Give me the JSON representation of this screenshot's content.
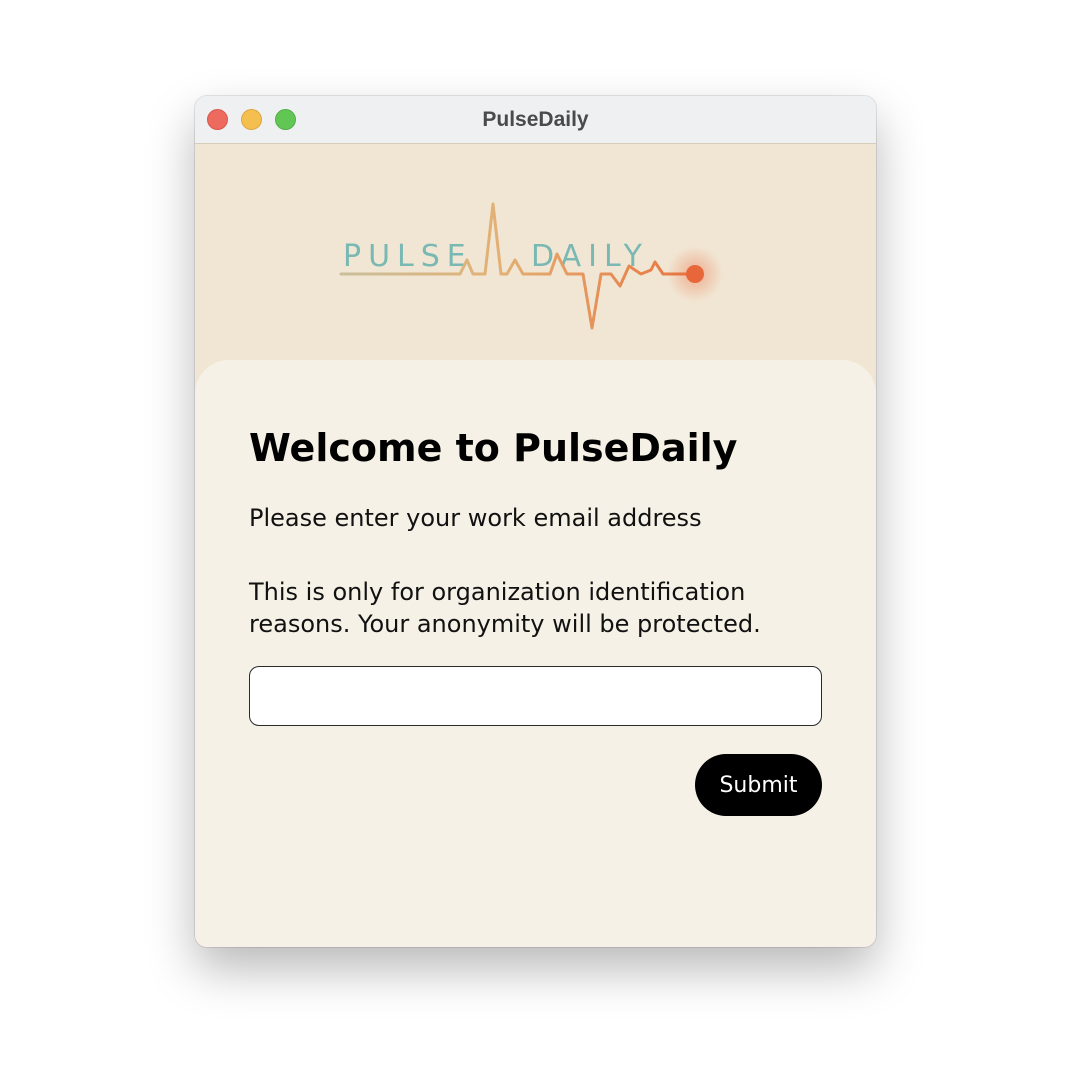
{
  "window": {
    "title": "PulseDaily"
  },
  "logo": {
    "word_left": "PULSE",
    "word_right": "DAILY",
    "colors": {
      "text": "#7ab8b4",
      "line_start": "#c9bf9a",
      "line_mid": "#e2b074",
      "line_end": "#e87440",
      "dot": "#e8673a"
    }
  },
  "main": {
    "heading": "Welcome to PulseDaily",
    "prompt": "Please enter your work email address",
    "info": "This is only for organization identification reasons. Your anonymity will be protected.",
    "email_field": {
      "value": "",
      "placeholder": ""
    },
    "submit_label": "Submit"
  },
  "colors": {
    "header_bg": "#f1e6d3",
    "card_bg": "#f6f1e6",
    "button_bg": "#000000",
    "button_text": "#ffffff"
  }
}
